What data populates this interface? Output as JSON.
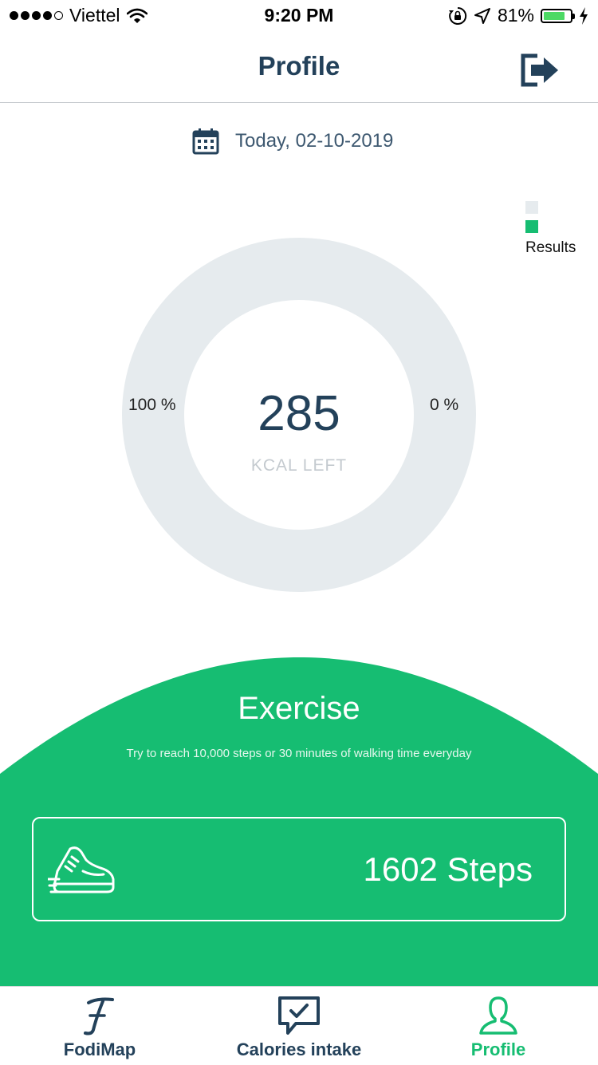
{
  "status_bar": {
    "carrier": "Viettel",
    "time": "9:20 PM",
    "battery_percent": "81%",
    "battery_level": 0.81,
    "signal_bars": 4,
    "icons": [
      "wifi-icon",
      "orientation-lock-icon",
      "location-arrow-icon",
      "battery-icon",
      "charging-bolt-icon"
    ]
  },
  "header": {
    "title": "Profile",
    "logout_icon": "logout-icon"
  },
  "date": {
    "icon": "calendar-icon",
    "label": "Today, 02-10-2019"
  },
  "legend": {
    "items": [
      {
        "color": "#e6ebee",
        "label": ""
      },
      {
        "color": "#16bd72",
        "label": "Results"
      }
    ]
  },
  "chart_data": {
    "type": "pie",
    "values": [
      100,
      0
    ],
    "colors": [
      "#e6ebee",
      "#16bd72"
    ],
    "left_label": "100 %",
    "right_label": "0 %",
    "center_value": "285",
    "center_label": "KCAL LEFT"
  },
  "exercise": {
    "title": "Exercise",
    "description": "Try to reach 10,000 steps or 30 minutes of walking time everyday",
    "steps_text": "1602 Steps",
    "icon": "sneaker-icon"
  },
  "tabbar": {
    "tabs": [
      {
        "label": "FodiMap",
        "icon": "fodimap-logo-icon",
        "active": false
      },
      {
        "label": "Calories intake",
        "icon": "chat-check-icon",
        "active": false
      },
      {
        "label": "Profile",
        "icon": "person-icon",
        "active": true
      }
    ]
  },
  "colors": {
    "primary_text": "#23415a",
    "accent_green": "#16bd72",
    "ring_gray": "#e6ebee",
    "muted_text": "#c4cacf"
  }
}
